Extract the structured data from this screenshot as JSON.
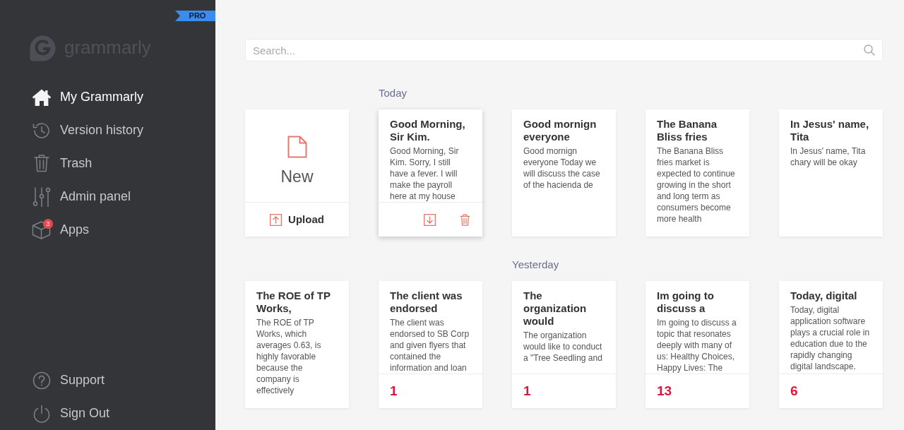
{
  "sidebar": {
    "badge": "PRO",
    "logo": "grammarly",
    "nav": [
      {
        "label": "My Grammarly",
        "selected": true
      },
      {
        "label": "Version history",
        "selected": false
      },
      {
        "label": "Trash",
        "selected": false
      },
      {
        "label": "Admin panel",
        "selected": false
      },
      {
        "label": "Apps",
        "selected": false,
        "badge": "3"
      }
    ],
    "footer": [
      {
        "label": "Support"
      },
      {
        "label": "Sign Out"
      }
    ]
  },
  "search": {
    "placeholder": "Search..."
  },
  "new_card": {
    "label": "New",
    "upload": "Upload"
  },
  "groups": [
    {
      "label": "Today",
      "documents": [
        {
          "title": "Good Morning, Sir Kim.",
          "preview": "Good Morning, Sir Kim. Sorry, I still have a fever. I will make the payroll here at my house",
          "hovered": true
        },
        {
          "title": "Good mornign everyone",
          "preview": "Good mornign everyone Today we will discuss the case of the hacienda de",
          "hovered": false
        },
        {
          "title": "The Banana Bliss fries",
          "preview": "The Banana Bliss fries market is expected to continue growing in the short and long term as consumers become more health",
          "hovered": false
        },
        {
          "title": "In Jesus' name, Tita",
          "preview": "In Jesus' name, Tita chary will be okay",
          "hovered": false
        },
        {
          "title": "The ROE of TP Works,",
          "preview": "The ROE of TP Works, which averages 0.63, is highly favorable because the company is effectively",
          "hovered": false
        },
        {
          "title": "The client was endorsed",
          "preview": "The client was endorsed to SB Corp and given flyers that contained the information and loan",
          "hovered": false,
          "score": "1"
        }
      ]
    },
    {
      "label": "Yesterday",
      "documents": [
        {
          "title": "The organization would",
          "preview": "The organization would like to conduct a \"Tree Seedling and",
          "hovered": false,
          "score": "1"
        },
        {
          "title": "Im going to discuss a",
          "preview": "Im going to discuss a topic that resonates deeply with many of us: Healthy Choices, Happy Lives: The",
          "hovered": false,
          "score": "13"
        },
        {
          "title": "Today, digital",
          "preview": "Today, digital application software plays a crucial role in education due to the rapidly changing digital landscape.",
          "hovered": false,
          "score": "6"
        }
      ]
    }
  ]
}
